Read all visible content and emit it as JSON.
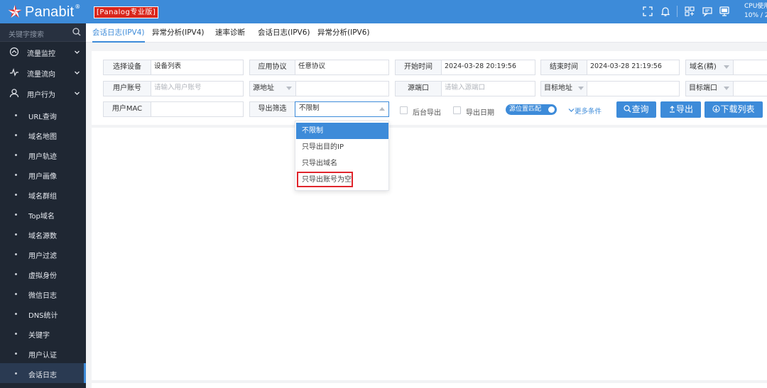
{
  "app": {
    "logo_text": "Panabit",
    "logo_reg": "®",
    "edition": "[Panalog专业版]",
    "cpu_line1": "CPU使用",
    "cpu_line2": "10% / 2"
  },
  "sidebar": {
    "search_placeholder": "关键字搜索",
    "menu": [
      {
        "label": "流量监控",
        "icon": "dashboard-icon"
      },
      {
        "label": "流量流向",
        "icon": "pulse-icon"
      },
      {
        "label": "用户行为",
        "icon": "user-icon"
      }
    ],
    "sub_items": [
      {
        "label": "URL查询"
      },
      {
        "label": "域名地图"
      },
      {
        "label": "用户轨迹"
      },
      {
        "label": "用户画像"
      },
      {
        "label": "域名群组"
      },
      {
        "label": "Top域名"
      },
      {
        "label": "域名源数"
      },
      {
        "label": "用户过滤"
      },
      {
        "label": "虚拟身份"
      },
      {
        "label": "微信日志"
      },
      {
        "label": "DNS统计"
      },
      {
        "label": "关键字"
      },
      {
        "label": "用户认证"
      },
      {
        "label": "会话日志",
        "active": true
      }
    ]
  },
  "tabs": [
    {
      "label": "会话日志(IPV4)",
      "active": true
    },
    {
      "label": "异常分析(IPV4)"
    },
    {
      "label": "速率诊断"
    },
    {
      "label": "会话日志(IPV6)"
    },
    {
      "label": "异常分析(IPV6)"
    }
  ],
  "form": {
    "device_label": "选择设备",
    "device_value": "设备列表",
    "protocol_label": "应用协议",
    "protocol_value": "任意协议",
    "start_label": "开始时间",
    "start_value": "2024-03-28 20:19:56",
    "end_label": "结束时间",
    "end_value": "2024-03-28 21:19:56",
    "domain_label": "域名(精)",
    "account_label": "用户账号",
    "account_placeholder": "请输入用户账号",
    "src_addr_label": "源地址",
    "src_port_label": "源端口",
    "src_port_placeholder": "请输入源端口",
    "dst_addr_label": "目标地址",
    "dst_port_label": "目标端口",
    "mac_label": "用户MAC",
    "export_filter_label": "导出筛选",
    "export_filter_value": "不限制",
    "bg_export_label": "后台导出",
    "export_date_label": "导出日期",
    "toggle_label": "源位置匹配",
    "more_label": "更多条件",
    "query_button": "查询",
    "export_button": "导出",
    "download_button": "下载列表"
  },
  "dropdown": {
    "options": [
      {
        "label": "不限制",
        "selected": true
      },
      {
        "label": "只导出目的IP"
      },
      {
        "label": "只导出域名"
      },
      {
        "label": "只导出账号为空",
        "highlighted": true
      }
    ]
  },
  "colors": {
    "topbar": "#3d8bd9",
    "sidebar": "#1f2733",
    "accent": "#3d8bd9",
    "highlight_border": "#e0252c"
  }
}
